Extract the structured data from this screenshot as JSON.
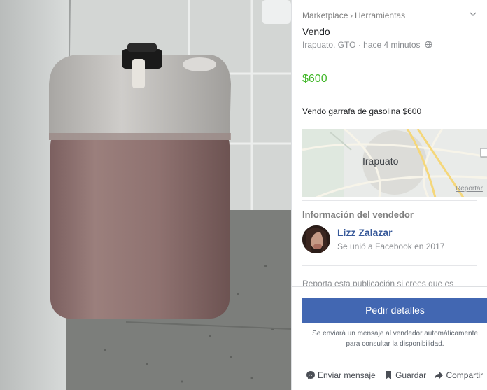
{
  "breadcrumb": {
    "marketplace": "Marketplace",
    "separator": "›",
    "category": "Herramientas"
  },
  "listing": {
    "title": "Vendo",
    "location": "Irapuato, GTO",
    "time_separator": " · ",
    "posted": "hace 4 minutos",
    "price": "$600",
    "description": "Vendo garrafa de gasolina  $600"
  },
  "map": {
    "city": "Irapuato",
    "report_link": "Reportar"
  },
  "seller": {
    "heading": "Información del vendedor",
    "name": "Lizz Zalazar",
    "joined": "Se unió a Facebook en 2017"
  },
  "report_text": "Reporta esta publicación si crees que es",
  "cta": {
    "label": "Pedir detalles"
  },
  "note": {
    "line1": "Se enviará un mensaje al vendedor automáticamente",
    "line2": "para consultar la disponibilidad."
  },
  "actions": {
    "message": "Enviar mensaje",
    "save": "Guardar",
    "share": "Compartir"
  },
  "colors": {
    "price": "#42b72a",
    "primary_button": "#4267b2",
    "link": "#365899"
  },
  "icons": [
    "chevron-down-icon",
    "globe-icon",
    "messenger-icon",
    "bookmark-icon",
    "share-icon"
  ]
}
